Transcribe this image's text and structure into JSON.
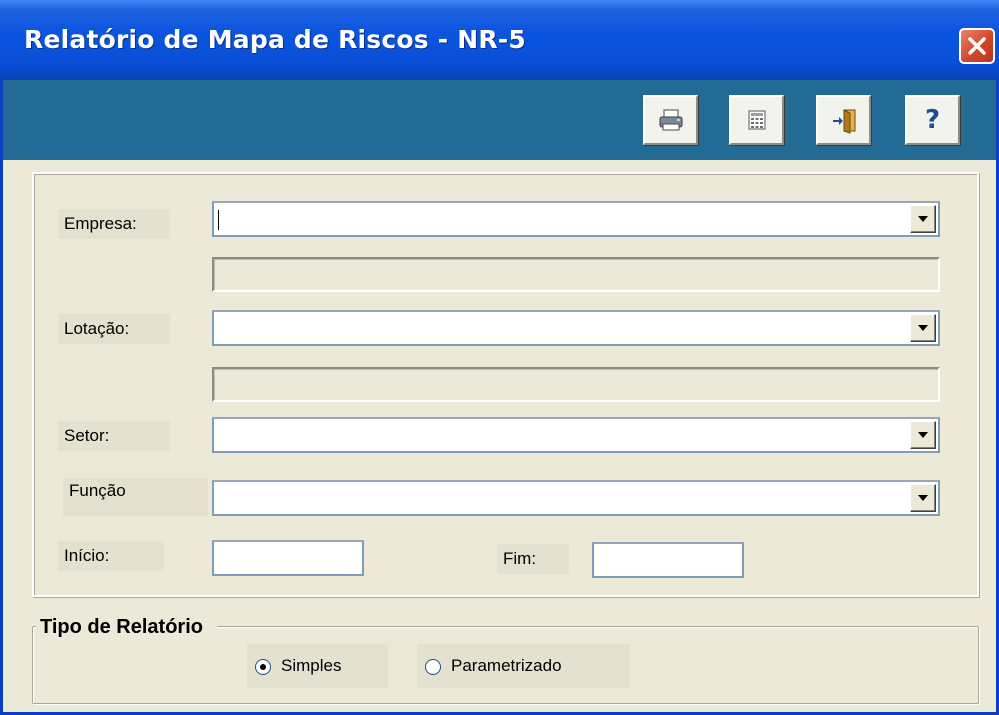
{
  "window": {
    "title": "Relatório de Mapa de Riscos - NR-5"
  },
  "toolbar": {
    "buttons": [
      {
        "name": "print",
        "icon": "printer-icon"
      },
      {
        "name": "calculator",
        "icon": "calculator-icon"
      },
      {
        "name": "exit",
        "icon": "exit-door-icon"
      },
      {
        "name": "help",
        "icon": "help-icon",
        "label": "?"
      }
    ]
  },
  "form": {
    "empresa": {
      "label": "Empresa:",
      "value": "",
      "description": ""
    },
    "lotacao": {
      "label": "Lotação:",
      "value": "",
      "description": ""
    },
    "setor": {
      "label": "Setor:",
      "value": ""
    },
    "funcao": {
      "label": "Função",
      "value": ""
    },
    "inicio": {
      "label": "Início:",
      "value": ""
    },
    "fim": {
      "label": "Fim:",
      "value": ""
    }
  },
  "report_type": {
    "title": "Tipo de Relatório",
    "options": [
      {
        "label": "Simples",
        "selected": true
      },
      {
        "label": "Parametrizado",
        "selected": false
      }
    ]
  },
  "colors": {
    "titlebar": "#0a4fd6",
    "toolbar": "#236b94",
    "panel": "#ece9d8",
    "close": "#d2472b"
  }
}
